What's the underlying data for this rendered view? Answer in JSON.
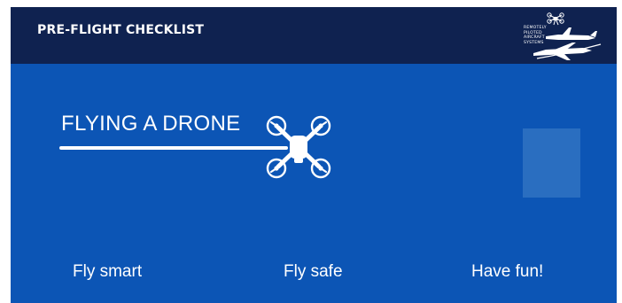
{
  "header": {
    "title": "PRE-FLIGHT CHECKLIST",
    "logo": {
      "lines": [
        "REMOTELY",
        "PILOTED",
        "AIRCRAFT",
        "SYSTEMS"
      ],
      "icon": "rpas-logo-icon"
    }
  },
  "hero": {
    "title": "FLYING A DRONE",
    "icon": "drone-icon"
  },
  "slogans": [
    "Fly smart",
    "Fly safe",
    "Have fun!"
  ],
  "colors": {
    "header_bg": "#0f2250",
    "body_bg": "#0c55b5",
    "text": "#ffffff",
    "placeholder": "#2a6ec0"
  }
}
